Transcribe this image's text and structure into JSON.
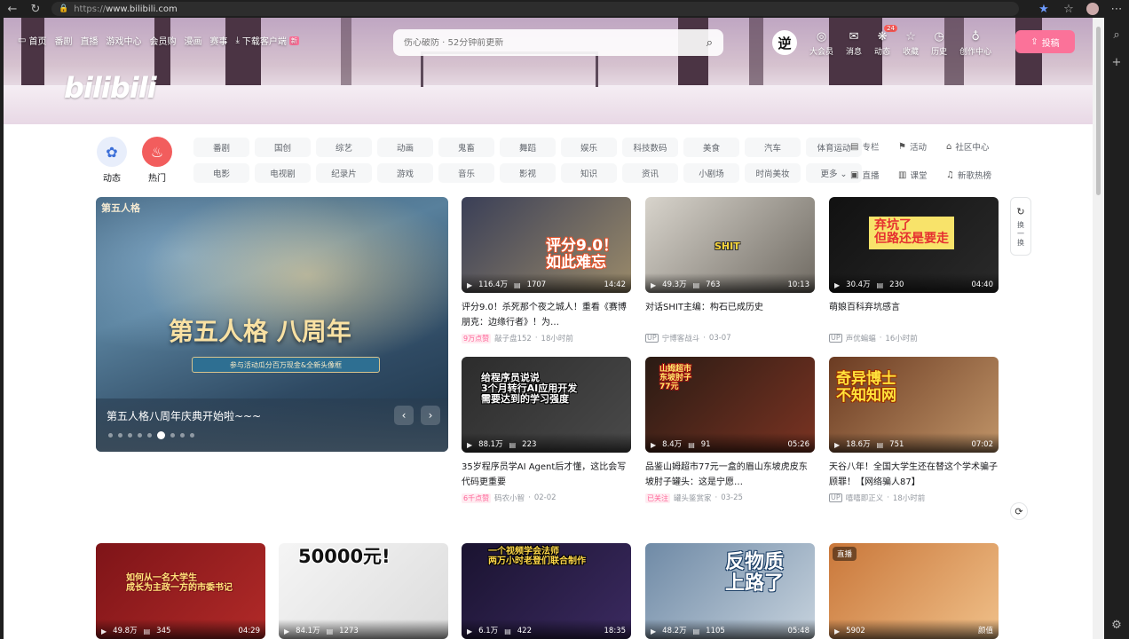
{
  "browser": {
    "url_scheme": "https://",
    "url_host": "www.bilibili.com"
  },
  "header": {
    "logo": "bilibili",
    "nav": [
      {
        "label": "首页",
        "icon": "tv-icon"
      },
      {
        "label": "番剧"
      },
      {
        "label": "直播"
      },
      {
        "label": "游戏中心"
      },
      {
        "label": "会员购"
      },
      {
        "label": "漫画"
      },
      {
        "label": "赛事"
      },
      {
        "label": "下载客户端",
        "icon": "download-icon",
        "badge": "新"
      }
    ],
    "search": {
      "placeholder": "伤心破防 · 52分钟前更新"
    },
    "avatar_text": "逆",
    "user_icons": [
      {
        "label": "大会员",
        "icon": "vip-icon"
      },
      {
        "label": "消息",
        "icon": "mail-icon"
      },
      {
        "label": "动态",
        "icon": "wind-icon",
        "badge": "24"
      },
      {
        "label": "收藏",
        "icon": "star-icon"
      },
      {
        "label": "历史",
        "icon": "clock-icon"
      },
      {
        "label": "创作中心",
        "icon": "bulb-icon"
      }
    ],
    "upload_label": "投稿"
  },
  "channels": {
    "dynamic_label": "动态",
    "hot_label": "热门",
    "categories": [
      "番剧",
      "国创",
      "综艺",
      "动画",
      "鬼畜",
      "舞蹈",
      "娱乐",
      "科技数码",
      "美食",
      "汽车",
      "体育运动",
      "电影",
      "电视剧",
      "纪录片",
      "游戏",
      "音乐",
      "影视",
      "知识",
      "资讯",
      "小剧场",
      "时尚美妆",
      "更多 ⌄"
    ],
    "side_links": [
      {
        "label": "专栏",
        "icon": "column-icon"
      },
      {
        "label": "活动",
        "icon": "flag-icon"
      },
      {
        "label": "社区中心",
        "icon": "community-icon"
      },
      {
        "label": "直播",
        "icon": "live-icon"
      },
      {
        "label": "课堂",
        "icon": "class-icon"
      },
      {
        "label": "新歌热榜",
        "icon": "music-icon"
      }
    ]
  },
  "carousel": {
    "corner_logo": "第五人格",
    "art_title": "第五人格 八周年",
    "art_subtitle": "参与活动瓜分百万现金&全新头像框",
    "caption": "第五人格八周年庆典开始啦~~~",
    "dot_count": 9,
    "active_dot": 5
  },
  "refresh": {
    "label": "换一换"
  },
  "videos": [
    {
      "views": "116.4万",
      "danmaku": "1707",
      "duration": "14:42",
      "title": "评分9.0！杀死那个夜之城人！重看《赛博朋克：边缘行者》！为…",
      "tag": "9万点赞",
      "uploader": "敲子盘152",
      "date": "18小时前",
      "thumb_text": "评分9.0！\n如此难忘",
      "colors": [
        "#3a3f57",
        "#9a8a6a"
      ]
    },
    {
      "views": "49.3万",
      "danmaku": "763",
      "duration": "10:13",
      "title": "对话SHIT主编：构石已成历史",
      "uploader": "宁博客战斗",
      "date": "03-07",
      "thumb_text": "SHIT",
      "colors": [
        "#d8d4cc",
        "#6f6a62"
      ]
    },
    {
      "views": "30.4万",
      "danmaku": "230",
      "duration": "04:40",
      "title": "萌娘百科弃坑感言",
      "uploader": "声优蝙蝠",
      "date": "16小时前",
      "thumb_text": "弃坑了\n但路还是要走",
      "colors": [
        "#111111",
        "#2a2a2a"
      ]
    },
    {
      "views": "88.1万",
      "danmaku": "223",
      "duration": "",
      "title": "35岁程序员学AI Agent后才懂，这比会写代码更重要",
      "tag": "6千点赞",
      "uploader": "码农小智",
      "date": "02-02",
      "thumb_text": "给程序员说说\n3个月转行AI应用开发\n需要达到的学习强度",
      "colors": [
        "#2c2c2c",
        "#4a4a4a"
      ]
    },
    {
      "views": "8.4万",
      "danmaku": "91",
      "duration": "05:26",
      "title": "品鉴山姆超市77元一盒的眉山东坡虎皮东坡肘子罐头：这是宁愿…",
      "tag": "已关注",
      "uploader": "罐头鉴赏家",
      "date": "03-25",
      "thumb_text": "山姆超市\n东坡肘子\n77元",
      "colors": [
        "#2a1b14",
        "#7a3322"
      ]
    },
    {
      "views": "18.6万",
      "danmaku": "751",
      "duration": "07:02",
      "title": "天谷八年！全国大学生还在替这个学术骗子顾罪！【网络骗人87】",
      "uploader": "嘻嘻即正义",
      "date": "18小时前",
      "thumb_text": "奇异博士\n不知知网",
      "colors": [
        "#6b3b22",
        "#c09468"
      ]
    },
    {
      "views": "49.8万",
      "danmaku": "345",
      "duration": "04:29",
      "title": "",
      "uploader": "",
      "date": "",
      "thumb_text": "如何从一名大学生\n成长为主政一方的市委书记",
      "colors": [
        "#7e1418",
        "#b12a28"
      ]
    },
    {
      "views": "84.1万",
      "danmaku": "1273",
      "duration": "",
      "title": "",
      "uploader": "",
      "date": "",
      "thumb_text": "50000元!",
      "colors": [
        "#f5f5f5",
        "#dcdcdc"
      ]
    },
    {
      "views": "6.1万",
      "danmaku": "422",
      "duration": "18:35",
      "title": "",
      "uploader": "",
      "date": "",
      "thumb_text": "一个视频学会法师\n两万小时老登们联合制作",
      "colors": [
        "#1a1330",
        "#3b2a60"
      ]
    },
    {
      "views": "48.2万",
      "danmaku": "1105",
      "duration": "05:48",
      "title": "",
      "uploader": "",
      "date": "",
      "thumb_text": "反物质\n上路了",
      "colors": [
        "#6f8aa6",
        "#c6d2dd"
      ]
    },
    {
      "views": "5902",
      "danmaku": "",
      "duration": "颜值",
      "title": "",
      "uploader": "",
      "date": "",
      "live_label": "直播",
      "thumb_text": "",
      "colors": [
        "#c9773a",
        "#f0c089"
      ]
    }
  ]
}
